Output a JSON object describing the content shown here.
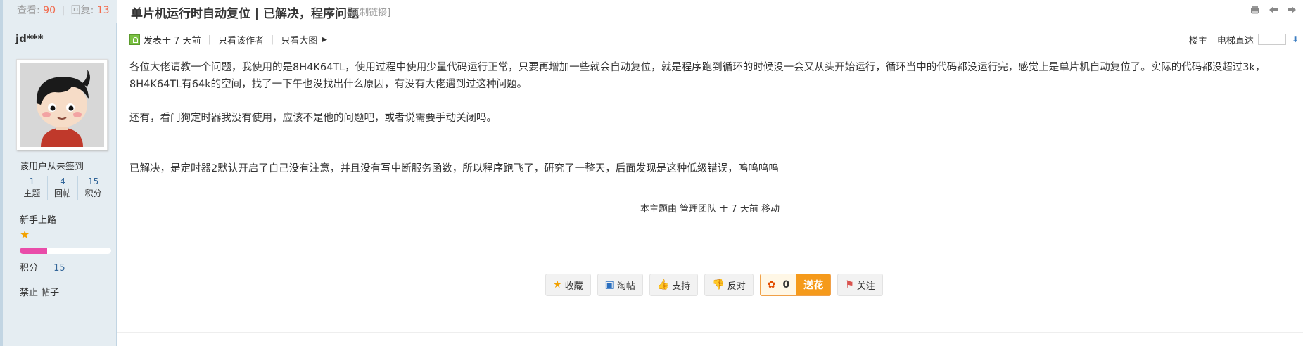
{
  "stats": {
    "views_label": "查看:",
    "views": "90",
    "replies_label": "回复:",
    "replies": "13"
  },
  "thread": {
    "title": "单片机运行时自动复位 | 已解决，程序问题",
    "copy_link": "[复制链接]"
  },
  "author": {
    "name": "jd***",
    "signin_text": "该用户从未签到",
    "stats": [
      {
        "value": "1",
        "label": "主题"
      },
      {
        "value": "4",
        "label": "回帖"
      },
      {
        "value": "15",
        "label": "积分"
      }
    ],
    "rank": "新手上路",
    "progress": 0.3,
    "score_label": "积分",
    "score_value": "15",
    "ban_text": "禁止 帖子"
  },
  "post_meta": {
    "posted": "发表于 7 天前",
    "only_author": "只看该作者",
    "big_image": "只看大图"
  },
  "floor": {
    "label": "楼主",
    "jump_label": "电梯直达"
  },
  "content": {
    "para1": "各位大佬请教一个问题，我使用的是8H4K64TL，使用过程中使用少量代码运行正常，只要再增加一些就会自动复位，就是程序跑到循环的时候没一会又从头开始运行，循环当中的代码都没运行完，感觉上是单片机自动复位了。实际的代码都没超过3k，8H4K64TL有64k的空间，找了一下午也没找出什么原因，有没有大佬遇到过这种问题。",
    "para2": "还有，看门狗定时器我没有使用，应该不是他的问题吧，或者说需要手动关闭吗。",
    "para3": "已解决，是定时器2默认开启了自己没有注意，并且没有写中断服务函数，所以程序跑飞了，研究了一整天，后面发现是这种低级错误，呜呜呜呜",
    "moved": "本主题由 管理团队 于 7 天前 移动"
  },
  "actions": {
    "favorite": "收藏",
    "taotie": "淘帖",
    "support": "支持",
    "oppose": "反对",
    "flower_count": "0",
    "send_flower": "送花",
    "follow": "关注"
  },
  "colors": {
    "accent": "#f26c4f",
    "sidebar_bg": "#e5edf2",
    "border": "#c2d5e3",
    "flower": "#f59a1b",
    "progress": "#e94ca9"
  }
}
